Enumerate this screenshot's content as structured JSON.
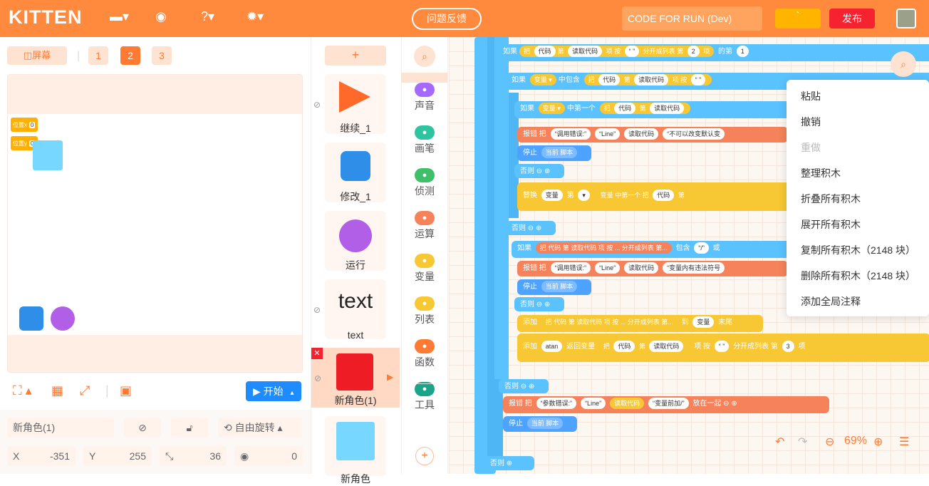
{
  "topbar": {
    "logo": "KITTEN",
    "feedback": "问题反馈",
    "project_name": "CODE FOR RUN (Dev)",
    "yellow_btn": "`",
    "publish": "发布",
    "icons": [
      "folder-icon",
      "bag-icon",
      "help-icon",
      "settings-icon"
    ]
  },
  "stage_toolbar": {
    "screen": "屏幕",
    "pages": [
      "1",
      "2",
      "3"
    ],
    "active_page": "2"
  },
  "stage": {
    "var_x_label": "位置x",
    "var_x_value": "0",
    "var_y_label": "位置y",
    "var_y_value": "0"
  },
  "controls": {
    "start": "开始"
  },
  "props": {
    "name": "新角色(1)",
    "rotate": "自由旋转",
    "x_label": "X",
    "x": "-351",
    "y_label": "Y",
    "y": "255",
    "size": "36",
    "direction": "0"
  },
  "sprites": {
    "add": "+",
    "items": [
      "继续_1",
      "修改_1",
      "运行",
      "text",
      "新角色(1)",
      "新角色"
    ],
    "text_icon": "text"
  },
  "categories": [
    {
      "label": "声音",
      "icon": "music-icon",
      "color": "#a569ff"
    },
    {
      "label": "画笔",
      "icon": "pen-icon",
      "color": "#2ec4a0"
    },
    {
      "label": "侦测",
      "icon": "detect-icon",
      "color": "#3fbf6a"
    },
    {
      "label": "运算",
      "icon": "calc-icon",
      "color": "#f5825a"
    },
    {
      "label": "变量",
      "icon": "variable-icon",
      "color": "#f7c833"
    },
    {
      "label": "列表",
      "icon": "list-icon",
      "color": "#f7c833"
    },
    {
      "label": "函数",
      "icon": "function-icon",
      "color": "#ff7b34"
    },
    {
      "label": "工具",
      "icon": "tools-icon",
      "color": "#1aa58a"
    }
  ],
  "context_menu": [
    {
      "label": "粘贴",
      "enabled": true
    },
    {
      "label": "撤销",
      "enabled": true
    },
    {
      "label": "重做",
      "enabled": false
    },
    {
      "label": "整理积木",
      "enabled": true
    },
    {
      "label": "折叠所有积木",
      "enabled": true
    },
    {
      "label": "展开所有积木",
      "enabled": true
    },
    {
      "label": "复制所有积木（2148 块）",
      "enabled": true
    },
    {
      "label": "删除所有积木（2148 块）",
      "enabled": true
    },
    {
      "label": "添加全局注释",
      "enabled": true
    }
  ],
  "canvas": {
    "zoom": "69%",
    "blocks": {
      "if1": "如果",
      "if2": "如果",
      "if3": "如果",
      "if4": "如果",
      "else": "否则",
      "error": "报错",
      "stop": "停止",
      "current_script": "当前 脚本",
      "replace": "替换",
      "add": "添加",
      "var": "变量",
      "contains": "中包含",
      "first_in": "中第一个",
      "code": "代码",
      "nth": "第",
      "read_code": "读取代码",
      "item": "项",
      "split": "分开成列表",
      "by": "按",
      "call_err": "“调用错误:”",
      "line": "“Line”",
      "cannot_change": "“不可以改变默认变",
      "illegal": "“变量内有违法符号",
      "param_err": "“参数错误:”",
      "var_prefix": "“变量前加/”",
      "put_together": "放在一起",
      "slash": "“/”",
      "or": "或",
      "end": "末尾",
      "to": "到",
      "atan": "atan",
      "return_var": "返回变量",
      "n2": "2",
      "n1": "1",
      "n3": "3",
      "long_row": "把 代码 第 读取代码 项 按 ... 分开成列表 第...",
      "include": "包含",
      "the_nth": "的第"
    }
  }
}
